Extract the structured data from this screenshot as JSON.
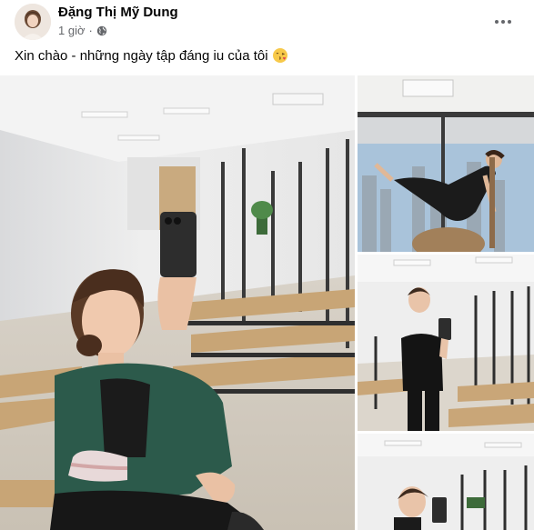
{
  "post": {
    "author": "Đặng Thị Mỹ Dung",
    "time": "1 giờ",
    "privacy_icon": "globe-icon",
    "more_icon": "more-options-icon",
    "caption": "Xin chào - những ngày tập đáng iu của tôi",
    "caption_emoji": "kissing-face-emoji"
  },
  "photos": [
    {
      "id": "photo-main",
      "subject": "selfie-in-pilates-studio"
    },
    {
      "id": "photo-2",
      "subject": "pilates-pose-by-window"
    },
    {
      "id": "photo-3",
      "subject": "mirror-selfie-black-outfit"
    },
    {
      "id": "photo-4",
      "subject": "mirror-selfie-studio"
    }
  ],
  "colors": {
    "name_text": "#050505",
    "meta_text": "#65676b",
    "background": "#ffffff"
  }
}
